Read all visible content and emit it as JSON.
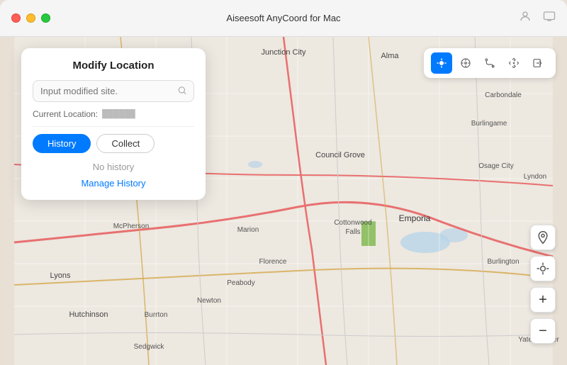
{
  "titleBar": {
    "title": "Aiseesoft AnyCoord for Mac",
    "trafficLights": [
      "red",
      "yellow",
      "green"
    ]
  },
  "panel": {
    "title": "Modify Location",
    "searchPlaceholder": "Input modified site.",
    "currentLocationLabel": "Current Location:",
    "currentLocationValue": "██████",
    "tabs": [
      {
        "id": "history",
        "label": "History",
        "active": true
      },
      {
        "id": "collect",
        "label": "Collect",
        "active": false
      }
    ],
    "noHistoryText": "No history",
    "manageHistoryLabel": "Manage History"
  },
  "toolbar": {
    "buttons": [
      {
        "id": "location",
        "icon": "◎",
        "active": true
      },
      {
        "id": "compass",
        "icon": "⊕",
        "active": false
      },
      {
        "id": "route",
        "icon": "⊗",
        "active": false
      },
      {
        "id": "move",
        "icon": "⊞",
        "active": false
      },
      {
        "id": "export",
        "icon": "↗",
        "active": false
      }
    ]
  },
  "mapSidebar": {
    "buttons": [
      {
        "id": "pin",
        "icon": "⦿",
        "label": "pin-icon"
      },
      {
        "id": "recenter",
        "icon": "⊕",
        "label": "recenter-icon"
      },
      {
        "id": "zoom-in",
        "icon": "+",
        "label": "zoom-in-icon"
      },
      {
        "id": "zoom-out",
        "icon": "−",
        "label": "zoom-out-icon"
      }
    ]
  }
}
